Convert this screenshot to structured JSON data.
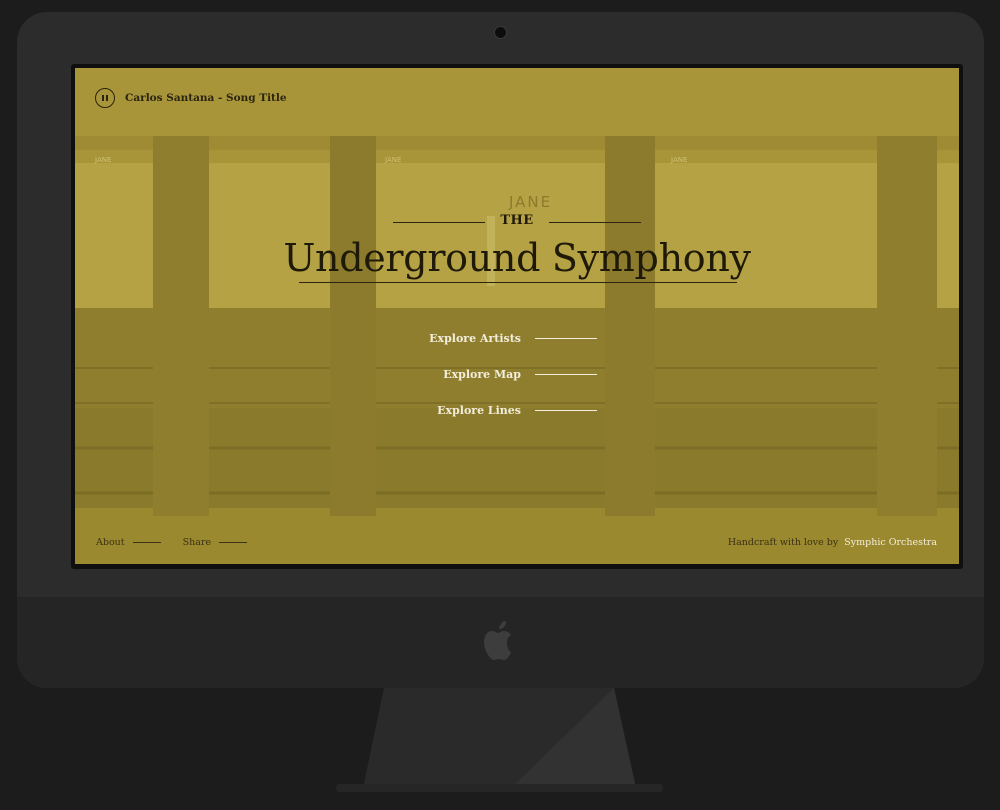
{
  "player": {
    "pause_icon": "pause-icon",
    "song_title": "Carlos Santana - Song Title"
  },
  "hero": {
    "kicker": "THE",
    "title": "Underground Symphony"
  },
  "menu": {
    "items": [
      {
        "label": "Explore Artists"
      },
      {
        "label": "Explore Map"
      },
      {
        "label": "Explore Lines"
      }
    ]
  },
  "footer": {
    "about": "About",
    "share": "Share",
    "credit_text": "Handcraft with love by",
    "credit_org": "Symphic Orchestra"
  },
  "background": {
    "station_signs": [
      "JANE",
      "JANE",
      "JANE",
      "JANE"
    ]
  },
  "colors": {
    "overlay": "#a89539",
    "dark_text": "#1f1a08",
    "light_text": "#f3eedb",
    "bezel": "#2c2c2d",
    "backdrop": "#1c1c1c"
  },
  "device": {
    "logo_icon": "apple-logo-icon",
    "camera_icon": "camera-icon"
  }
}
